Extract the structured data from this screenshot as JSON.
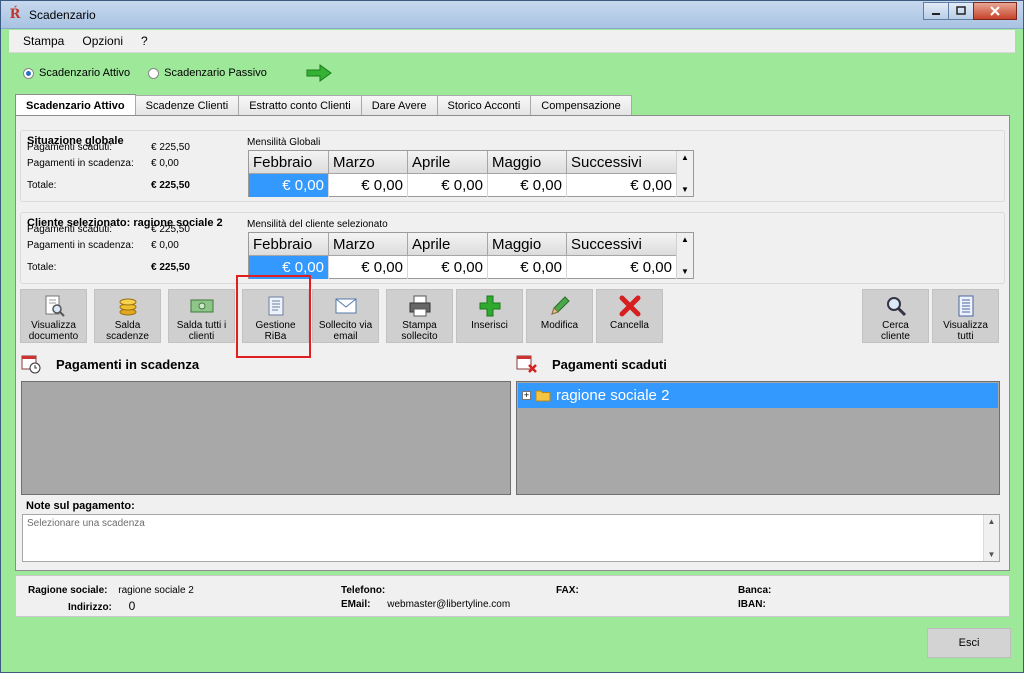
{
  "window": {
    "title": "Scadenzario",
    "app_icon_glyph": "Ŕ"
  },
  "menu": [
    "Stampa",
    "Opzioni",
    "?"
  ],
  "radios": {
    "attivo": "Scadenzario Attivo",
    "passivo": "Scadenzario Passivo",
    "selected": "attivo"
  },
  "tabs": [
    "Scadenzario Attivo",
    "Scadenze Clienti",
    "Estratto conto Clienti",
    "Dare Avere",
    "Storico Acconti",
    "Compensazione"
  ],
  "globale": {
    "title": "Situazione globale",
    "scaduti_label": "Pagamenti scaduti:",
    "scaduti_value": "€ 225,50",
    "scadenza_label": "Pagamenti in scadenza:",
    "scadenza_value": "€ 0,00",
    "totale_label": "Totale:",
    "totale_value": "€ 225,50",
    "grid_title": "Mensilità Globali",
    "columns": [
      "Febbraio",
      "Marzo",
      "Aprile",
      "Maggio",
      "Successivi"
    ],
    "values": [
      "€ 0,00",
      "€ 0,00",
      "€ 0,00",
      "€ 0,00",
      "€ 0,00"
    ]
  },
  "cliente": {
    "title": "Cliente selezionato: ragione sociale 2",
    "scaduti_label": "Pagamenti scaduti:",
    "scaduti_value": "€ 225,50",
    "scadenza_label": "Pagamenti in scadenza:",
    "scadenza_value": "€ 0,00",
    "totale_label": "Totale:",
    "totale_value": "€ 225,50",
    "grid_title": "Mensilità del cliente selezionato",
    "columns": [
      "Febbraio",
      "Marzo",
      "Aprile",
      "Maggio",
      "Successivi"
    ],
    "values": [
      "€ 0,00",
      "€ 0,00",
      "€ 0,00",
      "€ 0,00",
      "€ 0,00"
    ]
  },
  "toolbar": {
    "visualizza_documento": [
      "Visualizza",
      "documento"
    ],
    "salda_scadenze": [
      "Salda",
      "scadenze"
    ],
    "salda_tutti": [
      "Salda tutti i",
      "clienti"
    ],
    "gestione_riba": [
      "Gestione",
      "RiBa"
    ],
    "sollecito_email": [
      "Sollecito via",
      "email"
    ],
    "stampa_sollecito": [
      "Stampa",
      "sollecito"
    ],
    "inserisci": [
      "Inserisci"
    ],
    "modifica": [
      "Modifica"
    ],
    "cancella": [
      "Cancella"
    ],
    "cerca_cliente": [
      "Cerca",
      "cliente"
    ],
    "visualizza_tutti": [
      "Visualizza",
      "tutti"
    ]
  },
  "lists": {
    "in_scadenza_title": "Pagamenti in scadenza",
    "scaduti_title": "Pagamenti scaduti",
    "scaduti_item": "ragione sociale 2"
  },
  "note": {
    "label": "Note sul pagamento:",
    "placeholder": "Selezionare una scadenza"
  },
  "info": {
    "ragione_label": "Ragione sociale:",
    "ragione_value": "ragione sociale 2",
    "indirizzo_label": "Indirizzo:",
    "indirizzo_value": "0",
    "telefono_label": "Telefono:",
    "telefono_value": "",
    "email_label": "EMail:",
    "email_value": "webmaster@libertyline.com",
    "fax_label": "FAX:",
    "fax_value": "",
    "banca_label": "Banca:",
    "banca_value": "",
    "iban_label": "IBAN:",
    "iban_value": ""
  },
  "close_label": "Esci",
  "colors": {
    "window_bg": "#9ee89a",
    "selection": "#3399ff",
    "highlight": "#e02020"
  }
}
